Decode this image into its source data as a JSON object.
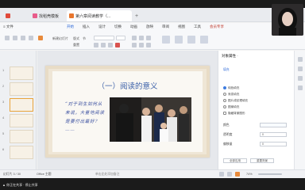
{
  "tabs": {
    "home": "",
    "template": "找稻壳模板",
    "doc": "第六章阅读教学（...",
    "add": "+"
  },
  "menu": [
    "≡ 文件",
    "开始",
    "插入",
    "设计",
    "切换",
    "动画",
    "放映",
    "审阅",
    "视图",
    "工具",
    "会员专享"
  ],
  "toolbar": {
    "new_slide": "新建幻灯片",
    "layout": "版式",
    "reset": "重置",
    "section": "节"
  },
  "slide": {
    "title": "（一）阅读的意义",
    "quote": "“对于到生如何从来说，大量地阅读是要付出最好？——"
  },
  "thumb_numbers": [
    "1",
    "2",
    "3",
    "4",
    "5",
    "6"
  ],
  "pane": {
    "title": "对象属性 ·",
    "fill_label": "填充",
    "options": [
      "纯色填充",
      "渐变填充",
      "图片或纹理填充",
      "图案填充",
      "隐藏背景图形"
    ],
    "transparency_label": "透明度",
    "transparency_value": "0",
    "color_label": "颜色",
    "offset_label": "偏移量",
    "offset_value": "0",
    "apply_all": "全部应用",
    "reset_bg": "重置背景"
  },
  "status": {
    "left": "幻灯片 3 / 30",
    "theme": "Office 主题",
    "notes": "单击此处添加备注",
    "zoom": "74%"
  },
  "meeting": {
    "text": "▲ 你正在共享 · 停止共享"
  },
  "colors": {
    "accent": "#3f7de0",
    "title_blue": "#3a5fa8",
    "slide_bg": "#efe6d6"
  }
}
